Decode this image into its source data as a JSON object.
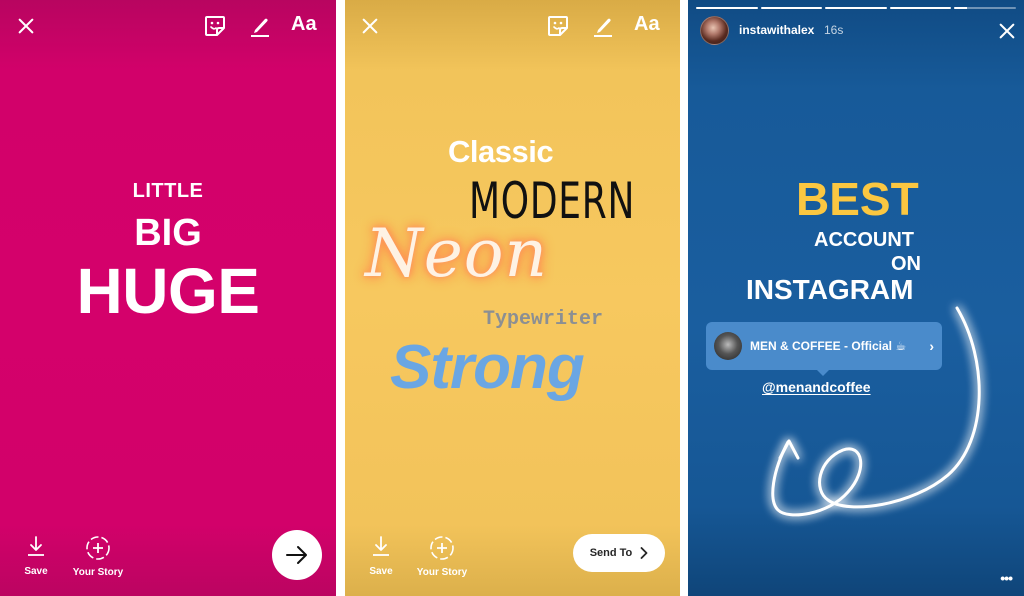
{
  "panels": {
    "pink": {
      "background": "#d4016b",
      "toolbar": {
        "close": "close-icon",
        "sticker": "sticker-icon",
        "draw": "pen-icon",
        "text_tool": "Aa"
      },
      "text_lines": [
        "LITTLE",
        "BIG",
        "HUGE"
      ],
      "bottom": {
        "save_label": "Save",
        "story_label": "Your Story",
        "next": "arrow-right-icon"
      }
    },
    "yellow": {
      "background": "#f7c85f",
      "toolbar": {
        "close": "close-icon",
        "sticker": "sticker-icon",
        "draw": "pen-icon",
        "text_tool": "Aa"
      },
      "font_samples": {
        "classic": "Classic",
        "modern": "MODERN",
        "neon": "Neon",
        "typewriter": "Typewriter",
        "strong": "Strong"
      },
      "bottom": {
        "save_label": "Save",
        "story_label": "Your Story",
        "send_label": "Send To"
      }
    },
    "blue": {
      "background": "#1a5e9f",
      "progress": [
        1,
        1,
        1,
        1,
        0.2
      ],
      "username": "instawithalex",
      "time": "16s",
      "headline": {
        "best": "BEST",
        "account": "ACCOUNT",
        "on": "ON",
        "instagram": "INSTAGRAM"
      },
      "mention_card": {
        "name": "MEN & COFFEE - Official ☕",
        "chevron": "›"
      },
      "handle": "@menandcoffee",
      "more": "•••",
      "accent_yellow": "#fbc741"
    }
  }
}
